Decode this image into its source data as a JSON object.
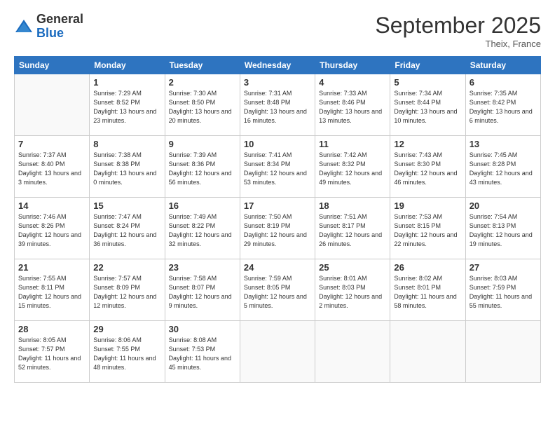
{
  "logo": {
    "general": "General",
    "blue": "Blue"
  },
  "header": {
    "month": "September 2025",
    "location": "Theix, France"
  },
  "days_of_week": [
    "Sunday",
    "Monday",
    "Tuesday",
    "Wednesday",
    "Thursday",
    "Friday",
    "Saturday"
  ],
  "weeks": [
    [
      {
        "day": "",
        "sunrise": "",
        "sunset": "",
        "daylight": ""
      },
      {
        "day": "1",
        "sunrise": "Sunrise: 7:29 AM",
        "sunset": "Sunset: 8:52 PM",
        "daylight": "Daylight: 13 hours and 23 minutes."
      },
      {
        "day": "2",
        "sunrise": "Sunrise: 7:30 AM",
        "sunset": "Sunset: 8:50 PM",
        "daylight": "Daylight: 13 hours and 20 minutes."
      },
      {
        "day": "3",
        "sunrise": "Sunrise: 7:31 AM",
        "sunset": "Sunset: 8:48 PM",
        "daylight": "Daylight: 13 hours and 16 minutes."
      },
      {
        "day": "4",
        "sunrise": "Sunrise: 7:33 AM",
        "sunset": "Sunset: 8:46 PM",
        "daylight": "Daylight: 13 hours and 13 minutes."
      },
      {
        "day": "5",
        "sunrise": "Sunrise: 7:34 AM",
        "sunset": "Sunset: 8:44 PM",
        "daylight": "Daylight: 13 hours and 10 minutes."
      },
      {
        "day": "6",
        "sunrise": "Sunrise: 7:35 AM",
        "sunset": "Sunset: 8:42 PM",
        "daylight": "Daylight: 13 hours and 6 minutes."
      }
    ],
    [
      {
        "day": "7",
        "sunrise": "Sunrise: 7:37 AM",
        "sunset": "Sunset: 8:40 PM",
        "daylight": "Daylight: 13 hours and 3 minutes."
      },
      {
        "day": "8",
        "sunrise": "Sunrise: 7:38 AM",
        "sunset": "Sunset: 8:38 PM",
        "daylight": "Daylight: 13 hours and 0 minutes."
      },
      {
        "day": "9",
        "sunrise": "Sunrise: 7:39 AM",
        "sunset": "Sunset: 8:36 PM",
        "daylight": "Daylight: 12 hours and 56 minutes."
      },
      {
        "day": "10",
        "sunrise": "Sunrise: 7:41 AM",
        "sunset": "Sunset: 8:34 PM",
        "daylight": "Daylight: 12 hours and 53 minutes."
      },
      {
        "day": "11",
        "sunrise": "Sunrise: 7:42 AM",
        "sunset": "Sunset: 8:32 PM",
        "daylight": "Daylight: 12 hours and 49 minutes."
      },
      {
        "day": "12",
        "sunrise": "Sunrise: 7:43 AM",
        "sunset": "Sunset: 8:30 PM",
        "daylight": "Daylight: 12 hours and 46 minutes."
      },
      {
        "day": "13",
        "sunrise": "Sunrise: 7:45 AM",
        "sunset": "Sunset: 8:28 PM",
        "daylight": "Daylight: 12 hours and 43 minutes."
      }
    ],
    [
      {
        "day": "14",
        "sunrise": "Sunrise: 7:46 AM",
        "sunset": "Sunset: 8:26 PM",
        "daylight": "Daylight: 12 hours and 39 minutes."
      },
      {
        "day": "15",
        "sunrise": "Sunrise: 7:47 AM",
        "sunset": "Sunset: 8:24 PM",
        "daylight": "Daylight: 12 hours and 36 minutes."
      },
      {
        "day": "16",
        "sunrise": "Sunrise: 7:49 AM",
        "sunset": "Sunset: 8:22 PM",
        "daylight": "Daylight: 12 hours and 32 minutes."
      },
      {
        "day": "17",
        "sunrise": "Sunrise: 7:50 AM",
        "sunset": "Sunset: 8:19 PM",
        "daylight": "Daylight: 12 hours and 29 minutes."
      },
      {
        "day": "18",
        "sunrise": "Sunrise: 7:51 AM",
        "sunset": "Sunset: 8:17 PM",
        "daylight": "Daylight: 12 hours and 26 minutes."
      },
      {
        "day": "19",
        "sunrise": "Sunrise: 7:53 AM",
        "sunset": "Sunset: 8:15 PM",
        "daylight": "Daylight: 12 hours and 22 minutes."
      },
      {
        "day": "20",
        "sunrise": "Sunrise: 7:54 AM",
        "sunset": "Sunset: 8:13 PM",
        "daylight": "Daylight: 12 hours and 19 minutes."
      }
    ],
    [
      {
        "day": "21",
        "sunrise": "Sunrise: 7:55 AM",
        "sunset": "Sunset: 8:11 PM",
        "daylight": "Daylight: 12 hours and 15 minutes."
      },
      {
        "day": "22",
        "sunrise": "Sunrise: 7:57 AM",
        "sunset": "Sunset: 8:09 PM",
        "daylight": "Daylight: 12 hours and 12 minutes."
      },
      {
        "day": "23",
        "sunrise": "Sunrise: 7:58 AM",
        "sunset": "Sunset: 8:07 PM",
        "daylight": "Daylight: 12 hours and 9 minutes."
      },
      {
        "day": "24",
        "sunrise": "Sunrise: 7:59 AM",
        "sunset": "Sunset: 8:05 PM",
        "daylight": "Daylight: 12 hours and 5 minutes."
      },
      {
        "day": "25",
        "sunrise": "Sunrise: 8:01 AM",
        "sunset": "Sunset: 8:03 PM",
        "daylight": "Daylight: 12 hours and 2 minutes."
      },
      {
        "day": "26",
        "sunrise": "Sunrise: 8:02 AM",
        "sunset": "Sunset: 8:01 PM",
        "daylight": "Daylight: 11 hours and 58 minutes."
      },
      {
        "day": "27",
        "sunrise": "Sunrise: 8:03 AM",
        "sunset": "Sunset: 7:59 PM",
        "daylight": "Daylight: 11 hours and 55 minutes."
      }
    ],
    [
      {
        "day": "28",
        "sunrise": "Sunrise: 8:05 AM",
        "sunset": "Sunset: 7:57 PM",
        "daylight": "Daylight: 11 hours and 52 minutes."
      },
      {
        "day": "29",
        "sunrise": "Sunrise: 8:06 AM",
        "sunset": "Sunset: 7:55 PM",
        "daylight": "Daylight: 11 hours and 48 minutes."
      },
      {
        "day": "30",
        "sunrise": "Sunrise: 8:08 AM",
        "sunset": "Sunset: 7:53 PM",
        "daylight": "Daylight: 11 hours and 45 minutes."
      },
      {
        "day": "",
        "sunrise": "",
        "sunset": "",
        "daylight": ""
      },
      {
        "day": "",
        "sunrise": "",
        "sunset": "",
        "daylight": ""
      },
      {
        "day": "",
        "sunrise": "",
        "sunset": "",
        "daylight": ""
      },
      {
        "day": "",
        "sunrise": "",
        "sunset": "",
        "daylight": ""
      }
    ]
  ]
}
